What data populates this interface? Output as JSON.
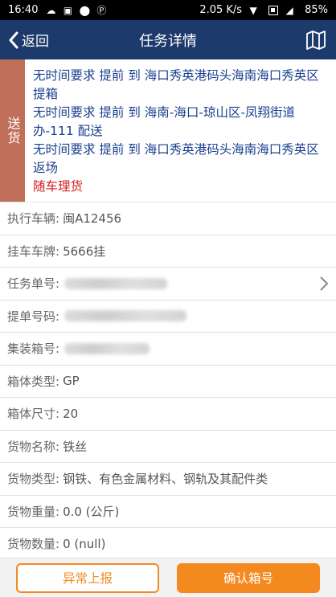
{
  "status_bar": {
    "time": "16:40",
    "network_speed": "2.05 K/s",
    "battery": "85%"
  },
  "header": {
    "back_label": "返回",
    "title": "任务详情"
  },
  "task": {
    "tag": "送货",
    "lines": [
      "无时间要求 提前 到 海口秀英港码头海南海口秀英区 提箱",
      "无时间要求 提前 到 海南-海口-琼山区-凤翔街道办-111 配送",
      "无时间要求 提前 到 海口秀英港码头海南海口秀英区 返场"
    ],
    "note": "随车理货"
  },
  "fields": {
    "vehicle": {
      "label": "执行车辆:",
      "value": "闽A12456"
    },
    "trailer": {
      "label": "挂车车牌:",
      "value": "5666挂"
    },
    "task_no": {
      "label": "任务单号:"
    },
    "bill_no": {
      "label": "提单号码:"
    },
    "container_no": {
      "label": "集装箱号:"
    },
    "box_type": {
      "label": "箱体类型:",
      "value": "GP"
    },
    "box_size": {
      "label": "箱体尺寸:",
      "value": "20"
    },
    "cargo_name": {
      "label": "货物名称:",
      "value": "铁丝"
    },
    "cargo_type": {
      "label": "货物类型:",
      "value": "钢铁、有色金属材料、钢轨及其配件类"
    },
    "cargo_weight": {
      "label": "货物重量:",
      "value": "0.0 (公斤)"
    },
    "cargo_qty": {
      "label": "货物数量:",
      "value": "0 (null)"
    }
  },
  "buttons": {
    "report": "异常上报",
    "confirm": "确认箱号"
  },
  "colors": {
    "header_bg": "#1c3a6b",
    "task_text": "#1a3f8f",
    "note_red": "#d41e1e",
    "tag_bg": "#c0705a",
    "accent_orange": "#f48a1f"
  }
}
